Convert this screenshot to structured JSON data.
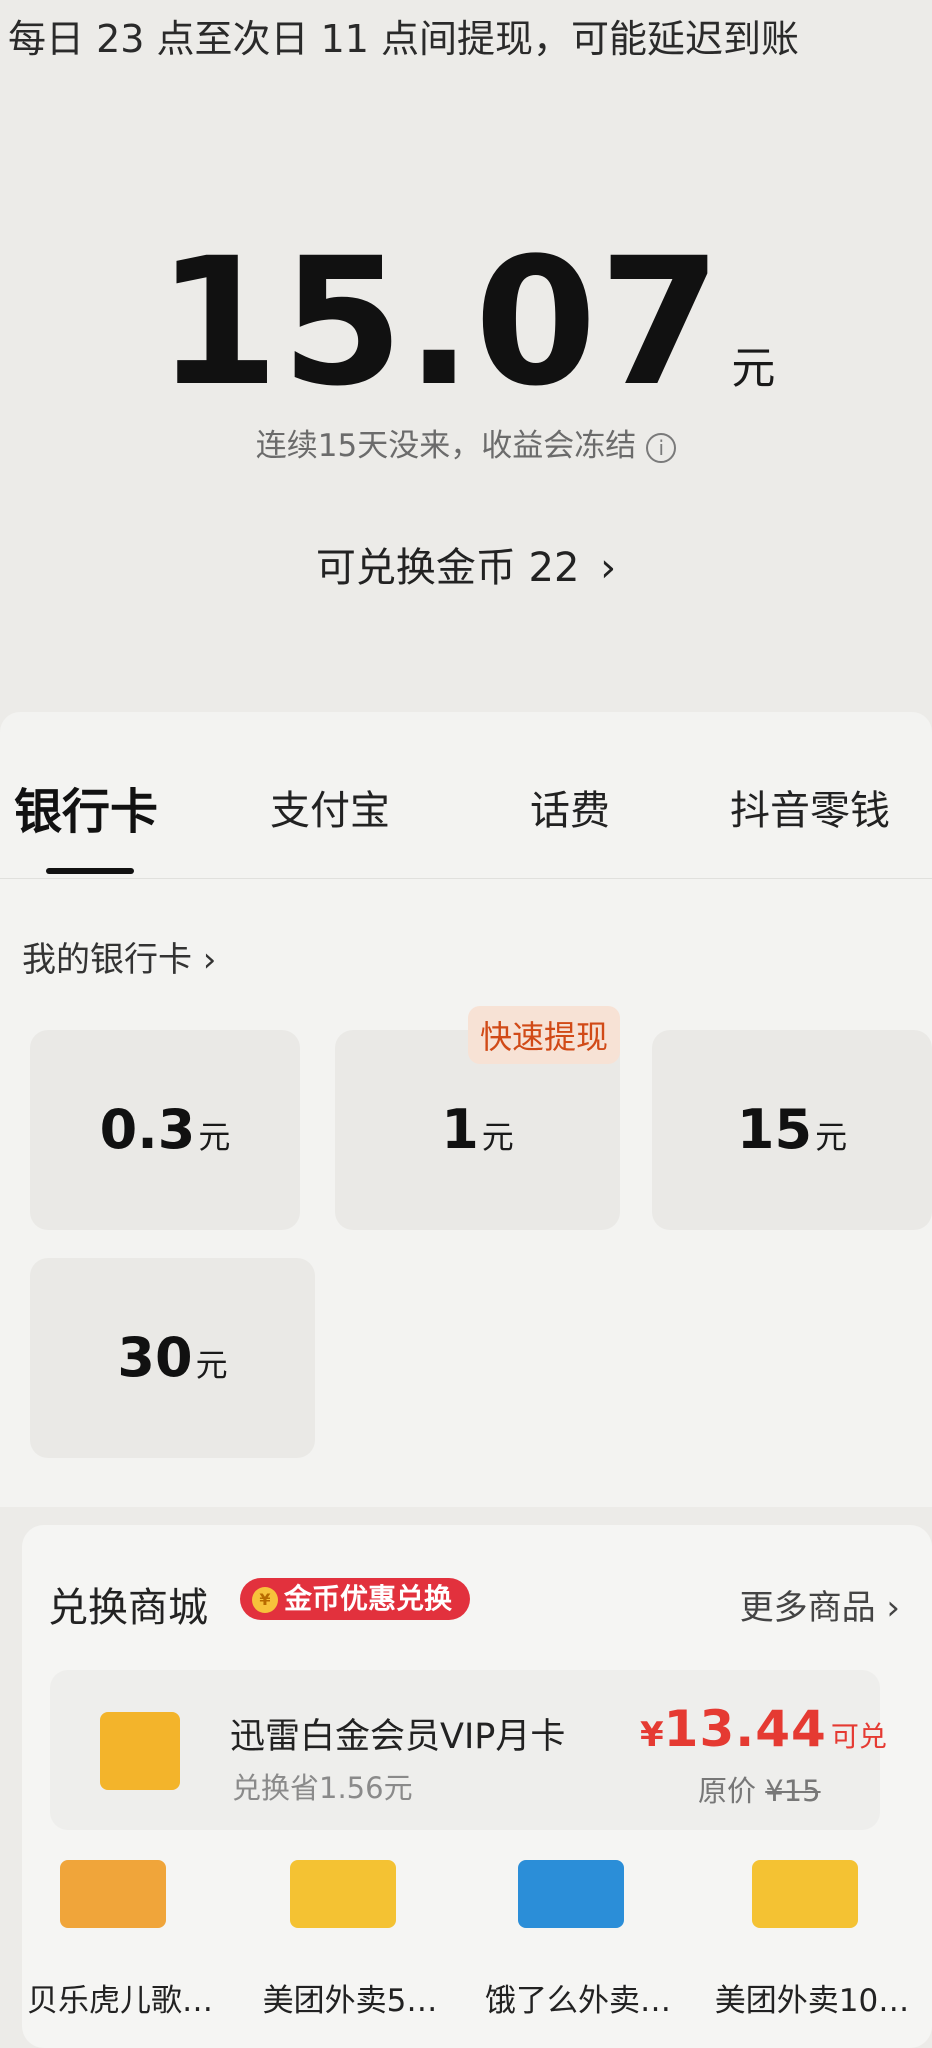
{
  "notice": "每日 23 点至次日 11 点间提现，可能延迟到账",
  "balance": {
    "amount": "15.07",
    "unit": "元"
  },
  "warning": "连续15天没来，收益会冻结",
  "coins": {
    "label": "可兑换金币 22",
    "arrow": "›"
  },
  "tabs": [
    {
      "label": "银行卡"
    },
    {
      "label": "支付宝"
    },
    {
      "label": "话费"
    },
    {
      "label": "抖音零钱"
    }
  ],
  "my_cards": "我的银行卡 ›",
  "fast_badge": "快速提现",
  "options": [
    {
      "value": "0.3",
      "unit": "元"
    },
    {
      "value": "1",
      "unit": "元"
    },
    {
      "value": "15",
      "unit": "元"
    },
    {
      "value": "30",
      "unit": "元"
    }
  ],
  "store": {
    "title": "兑换商城",
    "badge": "金币优惠兑换",
    "coin_symbol": "¥",
    "more": "更多商品 ›",
    "featured": {
      "name": "迅雷白金会员VIP月卡",
      "save": "兑换省1.56元",
      "currency": "¥",
      "price": "13.44",
      "price_label": "可兑",
      "orig_label": "原价",
      "orig_price": "¥15"
    },
    "products": [
      {
        "name": "贝乐虎儿歌…",
        "color": "#f0a53a"
      },
      {
        "name": "美团外卖5…",
        "color": "#f4c233"
      },
      {
        "name": "饿了么外卖…",
        "color": "#2b8ed8"
      },
      {
        "name": "美团外卖10…",
        "color": "#f4c233"
      }
    ]
  },
  "colors": {
    "accent": "#e2313d",
    "price": "#e53a32",
    "fast": "#d14a17"
  }
}
